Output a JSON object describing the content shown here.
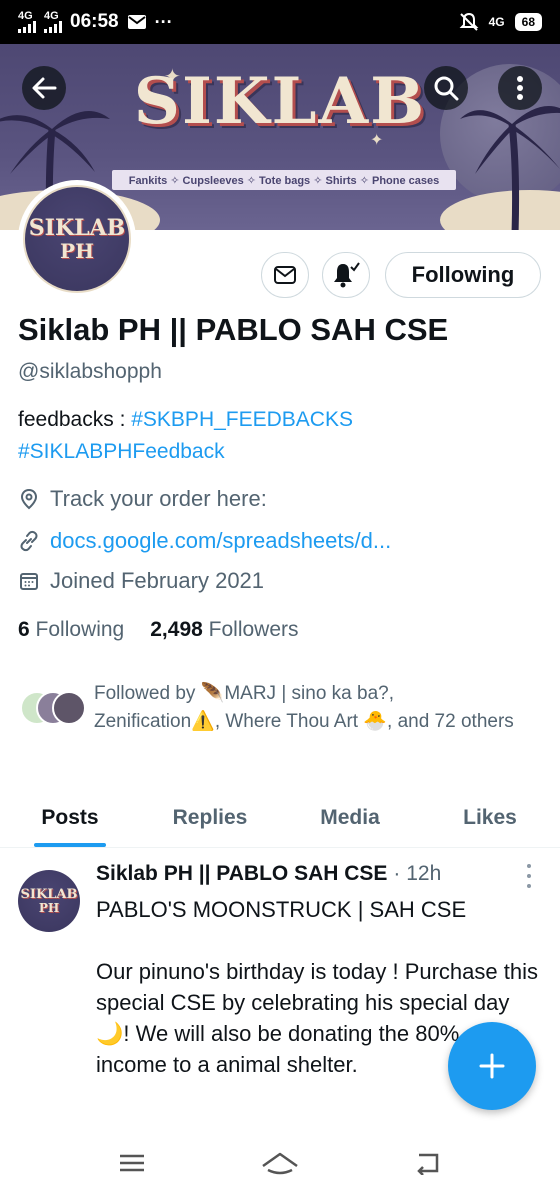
{
  "status_bar": {
    "network_1": "4G",
    "network_2": "4G",
    "time": "06:58",
    "right_network": "4G",
    "battery": "68"
  },
  "banner": {
    "title": "SIKLAB",
    "strip": "Fankits ✧ Cupsleeves ✧ Tote bags ✧ Shirts ✧ Phone cases"
  },
  "avatar": {
    "line1": "SIKLAB",
    "line2": "PH"
  },
  "actions": {
    "following_label": "Following"
  },
  "profile": {
    "name": "Siklab PH || PABLO SAH CSE",
    "handle": "@siklabshopph",
    "bio_prefix": "feedbacks : ",
    "bio_tag1": "#SKBPH_FEEDBACKS",
    "bio_tag2": "#SIKLABPHFeedback",
    "location": "Track your order here:",
    "website": "docs.google.com/spreadsheets/d...",
    "joined": "Joined February 2021",
    "following_count": "6",
    "following_label": "Following",
    "followers_count": "2,498",
    "followers_label": "Followers",
    "followed_by": "Followed by 🪶MARJ | sino ka ba?, Zenification⚠️, Where Thou Art 🐣, and 72 others"
  },
  "tabs": [
    "Posts",
    "Replies",
    "Media",
    "Likes"
  ],
  "tweet": {
    "avatar_line1": "SIKLAB",
    "avatar_line2": "PH",
    "author": "Siklab PH || PABLO SAH CSE",
    "time": "· 12h",
    "title": "PABLO'S MOONSTRUCK | SAH CSE",
    "body": "Our pinuno's birthday is today ! Purchase this special CSE by celebrating his special day🌙! We will also be donating the 80% of the income to a animal shelter."
  },
  "colors": {
    "accent": "#1d9bf0",
    "text": "#0f1419",
    "secondary": "#536471",
    "banner": "#4e4873"
  }
}
